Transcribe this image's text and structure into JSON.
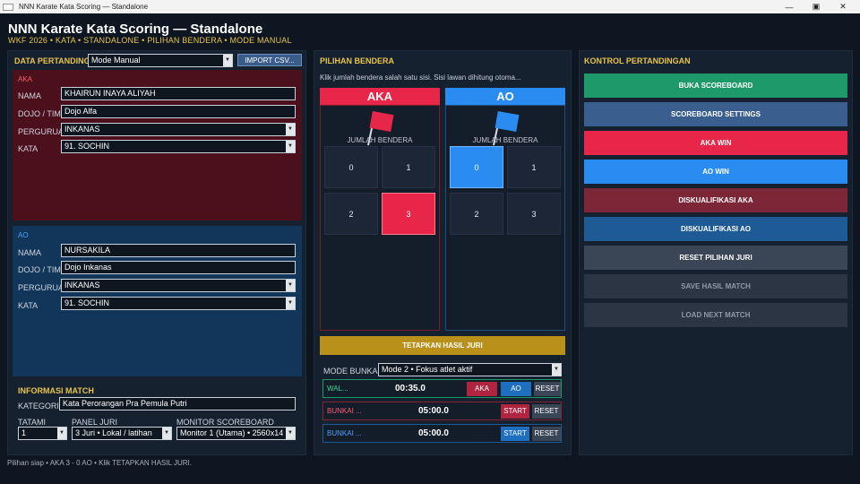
{
  "window": {
    "title": "NNN Karate Kata Scoring — Standalone",
    "minimize": "—",
    "maximize": "▣",
    "close": "✕"
  },
  "header": {
    "title": "NNN Karate Kata Scoring — Standalone",
    "subtitle": "WKF 2026 • KATA • STANDALONE • PILIHAN BENDERA • MODE MANUAL"
  },
  "left": {
    "section_title": "DATA PERTANDING",
    "mode_select": "Mode Manual",
    "import_button": "IMPORT CSV...",
    "aka": {
      "label": "AKA",
      "nama_label": "NAMA",
      "nama": "KHAIRUN INAYA ALIYAH",
      "dojo_label": "DOJO / TIM",
      "dojo": "Dojo Alfa",
      "perguruan_label": "PERGURUA",
      "perguruan": "INKANAS",
      "kata_label": "KATA",
      "kata": "91. SOCHIN"
    },
    "ao": {
      "label": "AO",
      "nama_label": "NAMA",
      "nama": "NURSAKILA",
      "dojo_label": "DOJO / TIM",
      "dojo": "Dojo Inkanas",
      "perguruan_label": "PERGURUA",
      "perguruan": "INKANAS",
      "kata_label": "KATA",
      "kata": "91. SOCHIN"
    },
    "info": {
      "title": "INFORMASI MATCH",
      "kategori_label": "KATEGORI",
      "kategori": "Kata Perorangan Pra Pemula Putri",
      "tatami_label": "TATAMI",
      "tatami": "1",
      "panel_label": "PANEL JURI",
      "panel": "3 Juri • Lokal / latihan",
      "monitor_label": "MONITOR SCOREBOARD",
      "monitor": "Monitor 1 (Utama) • 2560x14"
    }
  },
  "middle": {
    "section_title": "PILIHAN BENDERA",
    "hint": "Klik jumlah bendera salah satu sisi. Sisi lawan dihitung otoma...",
    "aka": {
      "head": "AKA",
      "jumlah_label": "JUMLAH BENDERA",
      "counts": [
        "0",
        "1",
        "2",
        "3"
      ],
      "selected": "3"
    },
    "ao": {
      "head": "AO",
      "jumlah_label": "JUMLAH BENDERA",
      "counts": [
        "0",
        "1",
        "2",
        "3"
      ],
      "selected": "0"
    },
    "tetapkan": "TETAPKAN HASIL JURI",
    "mode_bunkai_label": "MODE BUNKA",
    "mode_bunkai": "Mode 2 • Fokus atlet aktif",
    "timers": [
      {
        "label": "WAL...",
        "time": "00:35.0",
        "btn_aka": "AKA",
        "btn_ao": "AO",
        "btn_reset": "RESET"
      },
      {
        "label": "BUNKAI ...",
        "time": "05:00.0",
        "btn_start": "START",
        "btn_reset": "RESET"
      },
      {
        "label": "BUNKAI ...",
        "time": "05:00.0",
        "btn_start": "START",
        "btn_reset": "RESET"
      }
    ]
  },
  "right": {
    "section_title": "KONTROL PERTANDINGAN",
    "buttons": [
      "BUKA SCOREBOARD",
      "SCOREBOARD SETTINGS",
      "AKA WIN",
      "AO WIN",
      "DISKUALIFIKASI AKA",
      "DISKUALIFIKASI AO",
      "RESET PILIHAN JURI",
      "SAVE HASIL MATCH",
      "LOAD NEXT MATCH"
    ]
  },
  "status": "Pilihan siap • AKA 3 - 0 AO • Klik TETAPKAN HASIL JURI.",
  "colors": {
    "aka": "#e8264a",
    "ao": "#2a8cf0",
    "accent": "#e8c34a",
    "green": "#1e9a6a"
  }
}
